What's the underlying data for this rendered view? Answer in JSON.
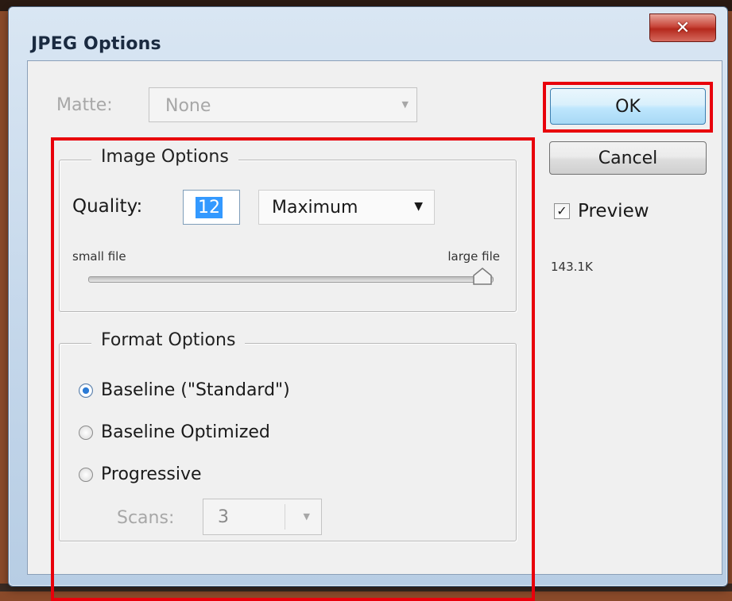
{
  "window": {
    "title": "JPEG Options",
    "close_glyph": "✕"
  },
  "matte": {
    "label": "Matte:",
    "value": "None",
    "enabled": false
  },
  "image_options": {
    "legend": "Image Options",
    "quality_label": "Quality:",
    "quality_value": "12",
    "quality_preset": "Maximum",
    "slider_small_label": "small file",
    "slider_large_label": "large file",
    "slider_level": 1.0
  },
  "format_options": {
    "legend": "Format Options",
    "options": [
      {
        "label": "Baseline (\"Standard\")",
        "checked": true
      },
      {
        "label": "Baseline Optimized",
        "checked": false
      },
      {
        "label": "Progressive",
        "checked": false
      }
    ],
    "scans_label": "Scans:",
    "scans_value": "3",
    "scans_enabled": false
  },
  "buttons": {
    "ok_label": "OK",
    "cancel_label": "Cancel"
  },
  "preview": {
    "label": "Preview",
    "checked": true,
    "check_glyph": "✓"
  },
  "file_size": "143.1K",
  "colors": {
    "highlight": "#e8000b",
    "ok_button_border": "#3c7fb1",
    "radio_selected": "#2b7bd6"
  },
  "icons": {
    "dropdown": "chevron-down-icon",
    "close": "close-icon",
    "slider_thumb": "triangle-thumb-icon"
  }
}
